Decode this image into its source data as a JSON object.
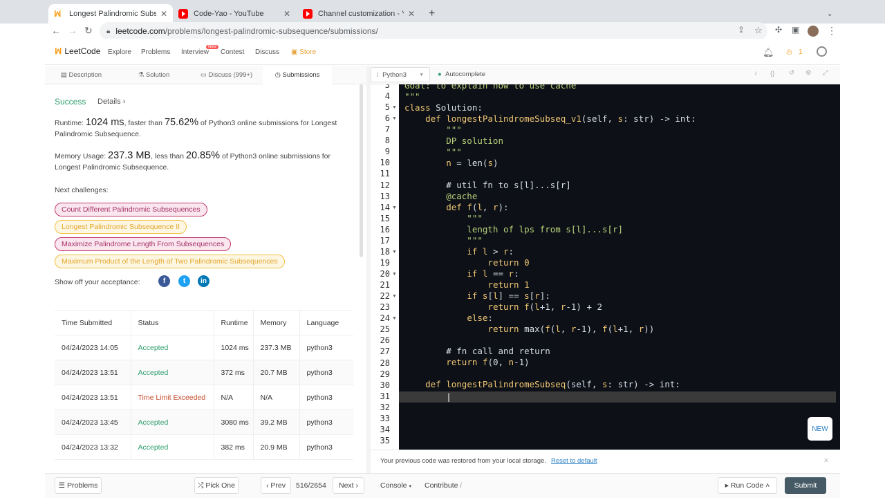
{
  "browser": {
    "tabs": [
      {
        "title": "Longest Palindromic Subseque",
        "close": "✕"
      },
      {
        "title": "Code-Yao - YouTube",
        "close": "✕"
      },
      {
        "title": "Channel customization - YouTu",
        "close": "✕"
      }
    ],
    "new_tab": "+",
    "url_host": "leetcode.com",
    "url_path": "/problems/longest-palindromic-subsequence/submissions/"
  },
  "header": {
    "logo": "LeetCode",
    "nav": [
      "Explore",
      "Problems",
      "Interview",
      "Contest",
      "Discuss",
      "Store"
    ],
    "new_badge": "New",
    "streak": "1"
  },
  "subtabs": [
    "Description",
    "Solution",
    "Discuss (999+)",
    "Submissions"
  ],
  "result": {
    "status": "Success",
    "details": "Details",
    "runtime_prefix": "Runtime: ",
    "runtime_value": "1024 ms",
    "runtime_mid": ", faster than ",
    "runtime_pct": "75.62%",
    "runtime_suffix": " of Python3 online submissions for Longest Palindromic Subsequence.",
    "memory_prefix": "Memory Usage: ",
    "memory_value": "237.3 MB",
    "memory_mid": ", less than ",
    "memory_pct": "20.85%",
    "memory_suffix": " of Python3 online submissions for Longest Palindromic Subsequence.",
    "next_label": "Next challenges:",
    "challenges": [
      "Count Different Palindromic Subsequences",
      "Longest Palindromic Subsequence II",
      "Maximize Palindrome Length From Subsequences",
      "Maximum Product of the Length of Two Palindromic Subsequences"
    ],
    "share_label": "Show off your acceptance:"
  },
  "table": {
    "headers": [
      "Time Submitted",
      "Status",
      "Runtime",
      "Memory",
      "Language"
    ],
    "rows": [
      [
        "04/24/2023 14:05",
        "Accepted",
        "1024 ms",
        "237.3 MB",
        "python3"
      ],
      [
        "04/24/2023 13:51",
        "Accepted",
        "372 ms",
        "20.7 MB",
        "python3"
      ],
      [
        "04/24/2023 13:51",
        "Time Limit Exceeded",
        "N/A",
        "N/A",
        "python3"
      ],
      [
        "04/24/2023 13:45",
        "Accepted",
        "3080 ms",
        "39.2 MB",
        "python3"
      ],
      [
        "04/24/2023 13:32",
        "Accepted",
        "382 ms",
        "20.9 MB",
        "python3"
      ]
    ]
  },
  "editor": {
    "language": "Python3",
    "autocomplete": "Autocomplete",
    "new_label": "NEW",
    "restore_msg": "Your previous code was restored from your local storage.",
    "reset_link": "Reset to default"
  },
  "bottom": {
    "problems": "Problems",
    "pick_one": "Pick One",
    "prev": "Prev",
    "page": "516/2654",
    "next": "Next",
    "console": "Console",
    "contribute": "Contribute",
    "run_code": "Run Code",
    "submit": "Submit"
  }
}
